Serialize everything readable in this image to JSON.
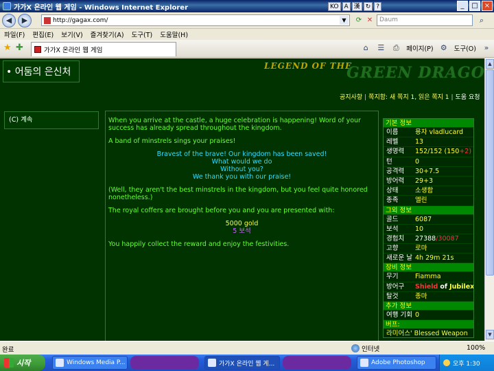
{
  "window": {
    "title": "가가X 온라인 웹 게임 - Windows Internet Explorer",
    "lang_indicators": [
      "KO",
      "A",
      "漢",
      "↻",
      "?"
    ]
  },
  "address": {
    "url": "http://gagax.com/",
    "search_placeholder": "Daum"
  },
  "menu": [
    "파일(F)",
    "편집(E)",
    "보기(V)",
    "즐겨찾기(A)",
    "도구(T)",
    "도움말(H)"
  ],
  "tab": {
    "title": "가가X 온라인 웹 게임"
  },
  "toolbar": {
    "page": "페이지(P)",
    "tools": "도구(O)"
  },
  "page": {
    "location": "• 어둠의 은신처",
    "logo_top": "LEGEND OF THE",
    "logo_main": "GREEN DRAGON",
    "topnav": [
      "공지사항",
      "쪽지함: 새 쪽지 1, 읽은 쪽지 1",
      "도움 요청"
    ],
    "leftnav": "(C) 계속",
    "story": {
      "p1": "When you arrive at the castle, a huge celebration is happening! Word of your success has already spread throughout the kingdom.",
      "p2": "A band of minstrels sings your praises!",
      "song": [
        "Bravest of the brave! Our kingdom has been saved!",
        "What would we do",
        "Without you?",
        "We thank you with our praise!"
      ],
      "p3": "(Well, they aren't the best minstrels in the kingdom, but you feel quite honored nonetheless.)",
      "p4": "The royal coffers are brought before you and you are presented with:",
      "gold": "5000 gold",
      "gems": "5 보석",
      "p5": "You happily collect the reward and enjoy the festivities."
    },
    "stats": {
      "sec_basic": "기본 정보",
      "name_k": "이름",
      "name_v": "용자 vladlucard",
      "level_k": "레벨",
      "level_v": "13",
      "hp_k": "생명력",
      "hp_a": "152/152",
      "hp_b": "(150",
      "hp_c": "+2)",
      "turns_k": "턴",
      "turns_v": "0",
      "atk_k": "공격력",
      "atk_v": "30+7.5",
      "def_k": "방어력",
      "def_v": "29+3",
      "status_k": "상태",
      "status_v": "소생함",
      "race_k": "종족",
      "race_v": "엘린",
      "sec_other": "그외 정보",
      "gold_k": "골드",
      "gold_v": "6087",
      "gem_k": "보석",
      "gem_v": "10",
      "exp_k": "경험치",
      "exp_a": "27388",
      "exp_b": "/30087",
      "home_k": "고향",
      "home_v": "로마",
      "newday_k": "새로운 날",
      "newday_v": "4h 29m 21s",
      "sec_equip": "장비 정보",
      "weapon_k": "무기",
      "weapon_v": "Fiamma",
      "armor_k": "방어구",
      "armor_a": "Shield",
      "armor_b": "of",
      "armor_c": "Jubilex",
      "mount_k": "탈것",
      "mount_v": "종마",
      "sec_extra": "추가 정보",
      "travel_k": "여행 기회",
      "travel_v": "0",
      "sec_buff": "버프:",
      "buff_v": "라미어스' Blessed Weapon"
    }
  },
  "statusbar": {
    "done": "완료",
    "zone": "인터넷",
    "zoom": "100%"
  },
  "taskbar": {
    "start": "시작",
    "items": [
      "Windows Media P...",
      "가가X 온라인 웹 게...",
      "Adobe Photoshop"
    ],
    "time": "오후 1:30"
  },
  "colors": {
    "page_bg": "#003300",
    "text_green": "#66ff33",
    "song_cyan": "#33ddff",
    "gold": "#ffff33"
  }
}
